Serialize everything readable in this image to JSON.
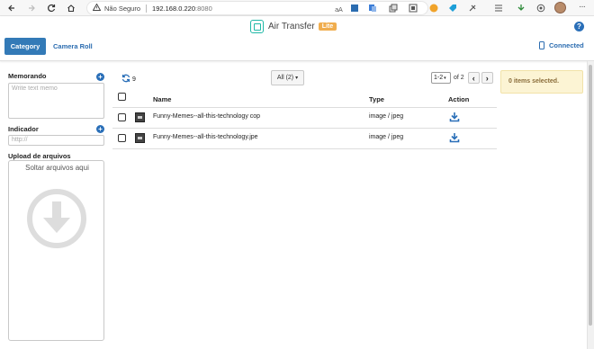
{
  "browser": {
    "insecure_label": "Não Seguro",
    "url_host": "192.168.0.220",
    "url_port": ":8080",
    "icons": [
      "back-icon",
      "forward-icon",
      "reload-icon",
      "home-icon",
      "warning-icon",
      "translate-icon",
      "extension-icon",
      "avatar"
    ]
  },
  "header": {
    "app_name": "Air Transfer",
    "badge": "Lite",
    "connection_status": "Connected",
    "tabs": [
      {
        "label": "Category",
        "active": true
      },
      {
        "label": "Camera Roll",
        "active": false
      }
    ],
    "accent_color": "#337ab7"
  },
  "sidebar": {
    "memo_label": "Memorando",
    "memo_placeholder": "Write text memo",
    "indicator_label": "Indicador",
    "url_placeholder": "http://",
    "upload_label": "Upload de arquivos",
    "drop_text": "Soltar arquivos aqui"
  },
  "toolbar": {
    "refresh_count": "9",
    "filter_label": "All (2)",
    "page_selected": "1-2",
    "page_of": "of 2"
  },
  "table": {
    "columns": {
      "name": "Name",
      "type": "Type",
      "action": "Action"
    },
    "rows": [
      {
        "name": "Funny-Memes--all-this-technology cop",
        "type": "image / jpeg"
      },
      {
        "name": "Funny-Memes--all-this-technology.jpe",
        "type": "image / jpeg"
      }
    ]
  },
  "selection": {
    "status": "0 items selected.",
    "color": "#fcf4d4"
  }
}
